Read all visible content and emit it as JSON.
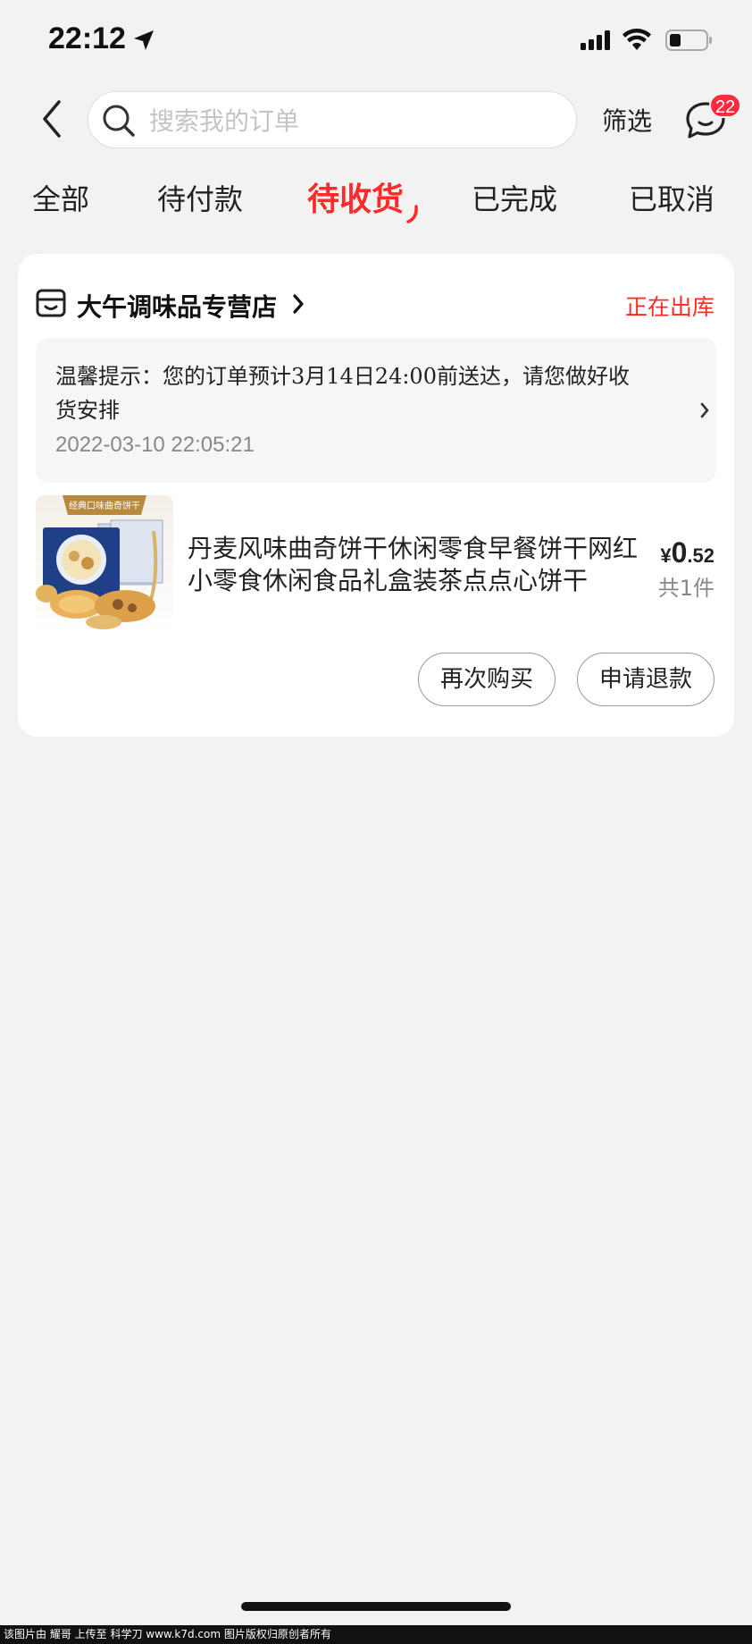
{
  "status_bar": {
    "time": "22:12",
    "icons": [
      "location-arrow-icon",
      "cellular-signal-icon",
      "wifi-icon",
      "battery-icon"
    ]
  },
  "header": {
    "search_placeholder": "搜索我的订单",
    "filter_label": "筛选",
    "message_badge": "22"
  },
  "tabs": [
    {
      "label": "全部",
      "active": false
    },
    {
      "label": "待付款",
      "active": false
    },
    {
      "label": "待收货",
      "active": true
    },
    {
      "label": "已完成",
      "active": false
    },
    {
      "label": "已取消",
      "active": false
    }
  ],
  "order": {
    "shop_name": "大午调味品专营店",
    "status": "正在出库",
    "notice": "温馨提示：您的订单预计3月14日24:00前送达，请您做好收货安排",
    "notice_time": "2022-03-10 22:05:21",
    "product": {
      "title": "丹麦风味曲奇饼干休闲零食早餐饼干网红小零食休闲食品礼盒装茶点点心饼干",
      "image_banner_text": "经典口味曲奇饼干",
      "price_currency": "¥",
      "price_integer": "0",
      "price_decimal": ".52",
      "quantity": "共1件"
    },
    "actions": {
      "rebuy": "再次购买",
      "refund": "申请退款"
    }
  },
  "footer": {
    "watermark": "该图片由 耀哥 上传至 科学刀 www.k7d.com 图片版权归原创者所有"
  },
  "colors": {
    "accent": "#ff2a2a",
    "background": "#f2f2f2",
    "badge": "#ff2a3b"
  }
}
